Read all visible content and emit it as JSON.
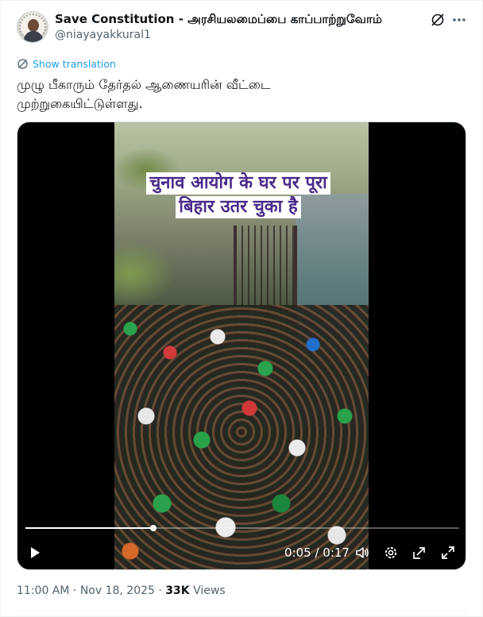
{
  "author": {
    "name": "Save Constitution - அரசியலமைப்பை காப்பாற்றுவோம்",
    "handle": "@niayayakkural1"
  },
  "header_icons": [
    "grok-icon",
    "more-icon"
  ],
  "translate": {
    "label": "Show translation",
    "icon": "globe-icon"
  },
  "tweet": {
    "text": "முழு பீகாரும் தேர்தல் ஆணையரின் வீட்டை முற்றுகையிட்டுள்ளது."
  },
  "video": {
    "caption_lines": [
      "चुनाव आयोग के घर पर पूरा",
      "बिहार उतर चुका है"
    ],
    "current_time": "0:05",
    "duration": "0:17",
    "time_display": "0:05 / 0:17",
    "progress_fraction": 0.294,
    "controls": [
      "play-icon",
      "volume-icon",
      "settings-icon",
      "pip-icon",
      "fullscreen-icon"
    ]
  },
  "meta": {
    "time": "11:00 AM",
    "separator": "·",
    "date": "Nov 18, 2025",
    "views_count": "33K",
    "views_label": "Views"
  },
  "colors": {
    "accent": "#1d9bf0",
    "text": "#0f1419",
    "secondary": "#536471",
    "caption_text": "#4b2a8a"
  }
}
